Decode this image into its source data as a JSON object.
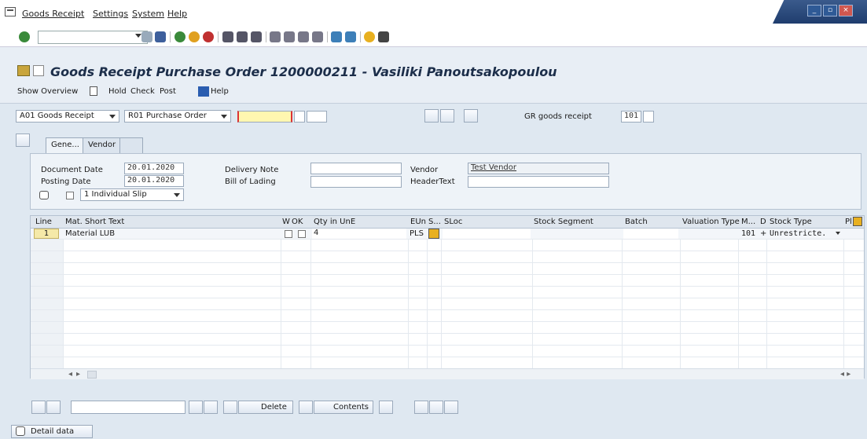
{
  "menu": [
    "Goods Receipt",
    "Settings",
    "System",
    "Help"
  ],
  "title": "Goods Receipt Purchase Order 1200000211 - Vasiliki Panoutsakopoulou",
  "app_toolbar": [
    "Show Overview",
    "Hold",
    "Check",
    "Post",
    "Help"
  ],
  "header": {
    "transaction": "A01 Goods Receipt",
    "reference": "R01 Purchase Order",
    "po_number": "",
    "gr_label": "GR goods receipt",
    "movement_type": "101"
  },
  "tabs": [
    "Gene...",
    "Vendor"
  ],
  "general": {
    "document_date_label": "Document Date",
    "document_date": "20.01.2020",
    "posting_date_label": "Posting Date",
    "posting_date": "20.01.2020",
    "slip": "1 Individual Slip",
    "delivery_note_label": "Delivery Note",
    "bill_label": "Bill of Lading",
    "vendor_label": "Vendor",
    "vendor": "Test Vendor",
    "headertext_label": "HeaderText"
  },
  "grid": {
    "columns": [
      "Line",
      "Mat. Short Text",
      "W",
      "OK",
      "Qty in UnE",
      "EUn",
      "S...",
      "SLoc",
      "Stock Segment",
      "Batch",
      "Valuation Type",
      "M...",
      "D",
      "Stock Type",
      "Pl"
    ],
    "rows": [
      {
        "line": "1",
        "text": "Material LUB",
        "qty": "4",
        "eun": "PLS",
        "mvt": "101",
        "d": "+",
        "stock_type": "Unrestricte."
      }
    ]
  },
  "bottom": {
    "delete": "Delete",
    "contents": "Contents",
    "detail": "Detail data"
  }
}
